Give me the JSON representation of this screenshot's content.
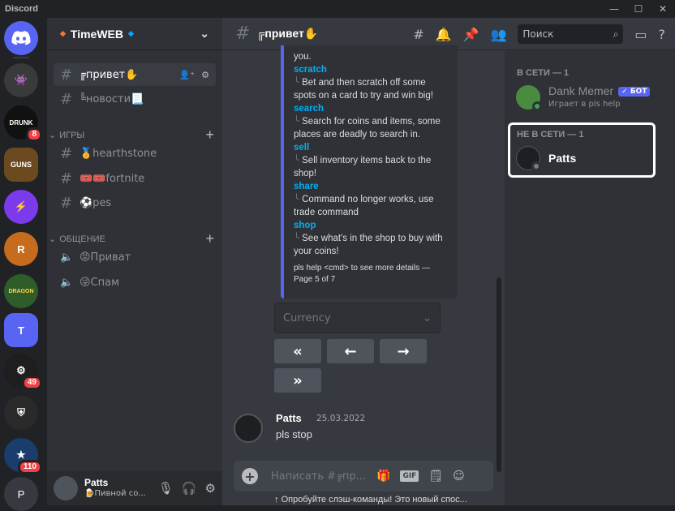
{
  "app": {
    "title": "Discord"
  },
  "window_controls": {
    "minimize": "—",
    "maximize": "☐",
    "close": "✕"
  },
  "guilds": [
    {
      "label": "",
      "color": "#5865f2",
      "icon": "discord-logo"
    },
    {
      "label": "",
      "color": "#3a3a3a",
      "icon": "pixel-avatar"
    },
    {
      "label": "DRUNK",
      "color": "#111111",
      "badge": "8"
    },
    {
      "label": "GUNS",
      "color": "#6b4a1f"
    },
    {
      "label": "",
      "color": "#7c3aed",
      "icon": "lightning"
    },
    {
      "label": "R",
      "color": "#c76b1d"
    },
    {
      "label": "DRAGON",
      "color": "#2f5d2a"
    },
    {
      "label": "T",
      "color": "#5865f2"
    },
    {
      "label": "",
      "color": "#1e1e1e",
      "badge": "49"
    },
    {
      "label": "",
      "color": "#2a2a2a",
      "icon": "shield"
    },
    {
      "label": "",
      "color": "#1a3d6b",
      "badge": "110"
    },
    {
      "label": "P",
      "color": "#36393f"
    }
  ],
  "server": {
    "name": "TimeWEB"
  },
  "channels": {
    "top": [
      {
        "name": "╔привет✋",
        "active": true
      },
      {
        "name": "╚новости📃",
        "active": false
      }
    ],
    "cat_games": "ИГРЫ",
    "games": [
      "🏅hearthstone",
      "🎟️🎟️fortnite",
      "⚽pes"
    ],
    "cat_talk": "ОБЩЕНИЕ",
    "voice": [
      "😡Приват",
      "😜Спам"
    ]
  },
  "user_panel": {
    "name": "Patts",
    "status": "🍺Пивной со..."
  },
  "chat": {
    "channel_title": "╔привет✋",
    "search_placeholder": "Поиск",
    "embed": {
      "top_text": "you.",
      "commands": [
        {
          "cmd": "scratch",
          "desc": "Bet and then scratch off some spots on a card to try and win big!"
        },
        {
          "cmd": "search",
          "desc": "Search for coins and items, some places are deadly to search in."
        },
        {
          "cmd": "sell",
          "desc": "Sell inventory items back to the shop!"
        },
        {
          "cmd": "share",
          "desc": "Command no longer works, use trade command"
        },
        {
          "cmd": "shop",
          "desc": "See what's in the shop to buy with your coins!"
        }
      ],
      "footer": "pls help <cmd> to see more details  — Page 5 of 7"
    },
    "select_placeholder": "Currency",
    "nav_buttons": [
      "«",
      "←",
      "→",
      "»"
    ],
    "message": {
      "author": "Patts",
      "timestamp": "25.03.2022",
      "text": "pls stop"
    },
    "composer_placeholder": "Написать #╔пр...",
    "tip": "Опробуйте слэш-команды! Это новый спос..."
  },
  "members": {
    "online_header": "В СЕТИ — 1",
    "offline_header": "НЕ В СЕТИ — 1",
    "online": [
      {
        "name": "Dank Memer",
        "tag": "✓ БОТ",
        "activity": "Играет в pls help"
      }
    ],
    "offline": [
      {
        "name": "Patts"
      }
    ]
  }
}
